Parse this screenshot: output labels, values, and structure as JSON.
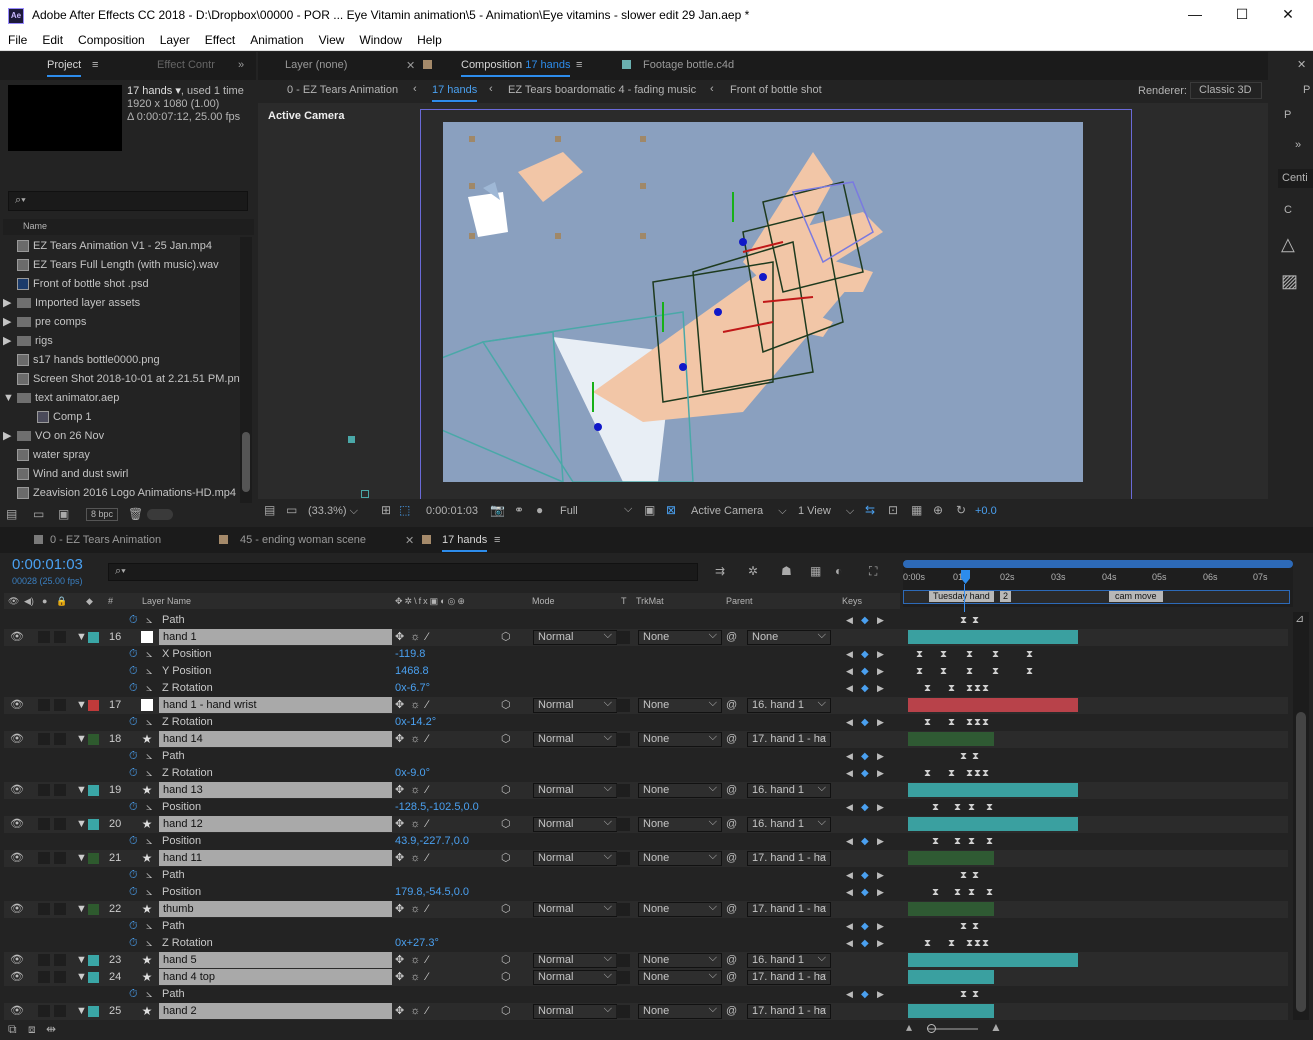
{
  "window": {
    "title": "Adobe After Effects CC 2018 - D:\\Dropbox\\00000 - POR ... Eye Vitamin animation\\5 - Animation\\Eye vitamins - slower edit 29 Jan.aep *",
    "app_icon": "Ae"
  },
  "menu": [
    "File",
    "Edit",
    "Composition",
    "Layer",
    "Effect",
    "Animation",
    "View",
    "Window",
    "Help"
  ],
  "project": {
    "tab_project": "Project",
    "tab_effect": "Effect Contr",
    "item_name": "17 hands",
    "used": ", used 1 time",
    "dims": "1920 x 1080 (1.00)",
    "duration": "Δ 0:00:07:12, 25.00 fps",
    "search_placeholder": "",
    "col_name": "Name",
    "items": [
      {
        "name": "EZ Tears Animation V1 - 25 Jan.mp4",
        "type": "file"
      },
      {
        "name": "EZ Tears Full Length (with music).wav",
        "type": "file"
      },
      {
        "name": "Front of bottle shot .psd",
        "type": "file"
      },
      {
        "name": "Imported layer assets",
        "type": "folder"
      },
      {
        "name": "pre comps",
        "type": "folder"
      },
      {
        "name": "rigs",
        "type": "folder"
      },
      {
        "name": "s17 hands bottle0000.png",
        "type": "file"
      },
      {
        "name": "Screen Shot 2018-10-01 at 2.21.51 PM.png",
        "type": "file"
      },
      {
        "name": "text animator.aep",
        "type": "folder-open"
      },
      {
        "name": "Comp 1",
        "type": "comp"
      },
      {
        "name": "VO on 26 Nov",
        "type": "folder"
      },
      {
        "name": "water spray",
        "type": "file"
      },
      {
        "name": "Wind and dust swirl",
        "type": "file"
      },
      {
        "name": "Zeavision 2016 Logo Animations-HD.mp4",
        "type": "file"
      }
    ],
    "bpc": "8 bpc"
  },
  "viewer": {
    "tab_layer": "Layer (none)",
    "tab_comp_prefix": "Composition",
    "tab_comp_name": "17 hands",
    "tab_footage": "Footage bottle.c4d",
    "breadcrumbs": [
      "0 - EZ Tears Animation",
      "17 hands",
      "EZ Tears boardomatic 4 - fading music",
      "Front of bottle shot"
    ],
    "renderer_label": "Renderer:",
    "renderer_value": "Classic 3D",
    "active_camera_label": "Active Camera",
    "zoom": "(33.3%)",
    "timecode": "0:00:01:03",
    "resolution": "Full",
    "camera_select": "Active Camera",
    "view_select": "1 View",
    "exposure": "+0.0"
  },
  "right_panel": {
    "items": [
      "P",
      "P",
      "Centi",
      "C"
    ]
  },
  "timeline": {
    "tabs": [
      "0 - EZ Tears Animation",
      "45 - ending woman scene",
      "17 hands"
    ],
    "timecode": "0:00:01:03",
    "frame_info": "00028 (25.00 fps)",
    "col_layer_name": "Layer Name",
    "col_mode": "Mode",
    "col_t": "T",
    "col_trkmat": "TrkMat",
    "col_parent": "Parent",
    "col_keys": "Keys",
    "ruler": [
      "0:00s",
      "01s",
      "02s",
      "03s",
      "04s",
      "05s",
      "06s",
      "07s"
    ],
    "markers": [
      "Tuesday hand",
      "2",
      "cam move"
    ],
    "rows": [
      {
        "kind": "prop",
        "name": "Path",
        "value": ""
      },
      {
        "kind": "layer",
        "num": "16",
        "name": "hand 1",
        "mode": "Normal",
        "trkmat": "None",
        "parent": "None",
        "color": "#3aa6a6",
        "solid": true
      },
      {
        "kind": "prop",
        "name": "X Position",
        "value": "-119.8"
      },
      {
        "kind": "prop",
        "name": "Y Position",
        "value": "1468.8"
      },
      {
        "kind": "prop",
        "name": "Z Rotation",
        "value": "0x-6.7°"
      },
      {
        "kind": "layer",
        "num": "17",
        "name": "hand 1 - hand wrist",
        "mode": "Normal",
        "trkmat": "None",
        "parent": "16. hand 1",
        "color": "#c03a3a",
        "solid": true
      },
      {
        "kind": "prop",
        "name": "Z Rotation",
        "value": "0x-14.2°"
      },
      {
        "kind": "layer",
        "num": "18",
        "name": "hand 14",
        "mode": "Normal",
        "trkmat": "None",
        "parent": "17. hand 1 - ha",
        "color": "#2e5a2e",
        "solid": false
      },
      {
        "kind": "prop",
        "name": "Path",
        "value": ""
      },
      {
        "kind": "prop",
        "name": "Z Rotation",
        "value": "0x-9.0°"
      },
      {
        "kind": "layer",
        "num": "19",
        "name": "hand 13",
        "mode": "Normal",
        "trkmat": "None",
        "parent": "16. hand 1",
        "color": "#3aa6a6",
        "solid": false
      },
      {
        "kind": "prop",
        "name": "Position",
        "value": "-128.5,-102.5,0.0"
      },
      {
        "kind": "layer",
        "num": "20",
        "name": "hand 12",
        "mode": "Normal",
        "trkmat": "None",
        "parent": "16. hand 1",
        "color": "#3aa6a6",
        "solid": false
      },
      {
        "kind": "prop",
        "name": "Position",
        "value": "43.9,-227.7,0.0"
      },
      {
        "kind": "layer",
        "num": "21",
        "name": "hand 11",
        "mode": "Normal",
        "trkmat": "None",
        "parent": "17. hand 1 - ha",
        "color": "#2e5a2e",
        "solid": false
      },
      {
        "kind": "prop",
        "name": "Path",
        "value": ""
      },
      {
        "kind": "prop",
        "name": "Position",
        "value": "179.8,-54.5,0.0"
      },
      {
        "kind": "layer",
        "num": "22",
        "name": "thumb",
        "mode": "Normal",
        "trkmat": "None",
        "parent": "17. hand 1 - ha",
        "color": "#2e5a2e",
        "solid": false
      },
      {
        "kind": "prop",
        "name": "Path",
        "value": ""
      },
      {
        "kind": "prop",
        "name": "Z Rotation",
        "value": "0x+27.3°"
      },
      {
        "kind": "layer",
        "num": "23",
        "name": "hand 5",
        "mode": "Normal",
        "trkmat": "None",
        "parent": "16. hand 1",
        "color": "#3aa6a6",
        "solid": false
      },
      {
        "kind": "layer",
        "num": "24",
        "name": "hand 4 top",
        "mode": "Normal",
        "trkmat": "None",
        "parent": "17. hand 1 - ha",
        "color": "#3aa6a6",
        "solid": false
      },
      {
        "kind": "prop",
        "name": "Path",
        "value": ""
      },
      {
        "kind": "layer",
        "num": "25",
        "name": "hand 2",
        "mode": "Normal",
        "trkmat": "None",
        "parent": "17. hand 1 - ha",
        "color": "#3aa6a6",
        "solid": false
      }
    ]
  }
}
